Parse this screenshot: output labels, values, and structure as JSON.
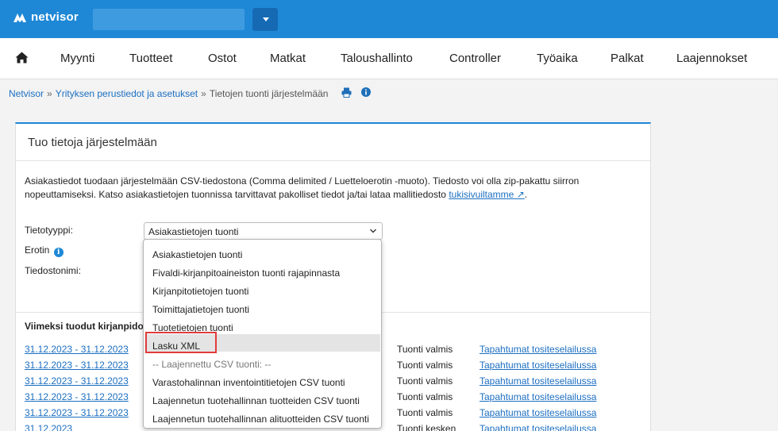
{
  "brand": {
    "name": "netvisor",
    "logo_icon": "netvisor-logo-icon"
  },
  "nav": {
    "home_icon": "home-icon",
    "items": [
      "Myynti",
      "Tuotteet",
      "Ostot",
      "Matkat",
      "Taloushallinto",
      "Controller",
      "Työaika",
      "Palkat",
      "Laajennokset"
    ]
  },
  "breadcrumb": {
    "items": [
      "Netvisor",
      "Yrityksen perustiedot ja asetukset",
      "Tietojen tuonti järjestelmään"
    ],
    "separator": "»",
    "icons": [
      "print-icon",
      "info-icon"
    ]
  },
  "panel": {
    "title": "Tuo tietoja järjestelmään",
    "description": "Asiakastiedot tuodaan järjestelmään CSV-tiedostona (Comma delimited / Luetteloerotin -muoto). Tiedosto voi olla zip-pakattu siirron nopeuttamiseksi. Katso asiakastietojen tuonnissa tarvittavat pakolliset tiedot ja/tai lataa mallitiedosto",
    "support_link": "tukisivuiltamme",
    "fields": {
      "type_label": "Tietotyyppi:",
      "type_value": "Asiakastietojen tuonti",
      "separator_label": "Erotin",
      "filename_label": "Tiedostonimi:"
    },
    "recent_title": "Viimeksi tuodut kirjanpido",
    "recent_rows": [
      {
        "date": "31.12.2023 - 31.12.2023",
        "status": "Tuonti valmis",
        "link": "Tapahtumat tositeselailussa"
      },
      {
        "date": "31.12.2023 - 31.12.2023",
        "status": "Tuonti valmis",
        "link": "Tapahtumat tositeselailussa"
      },
      {
        "date": "31.12.2023 - 31.12.2023",
        "status": "Tuonti valmis",
        "link": "Tapahtumat tositeselailussa"
      },
      {
        "date": "31.12.2023 - 31.12.2023",
        "status": "Tuonti valmis",
        "link": "Tapahtumat tositeselailussa"
      },
      {
        "date": "31.12.2023 - 31.12.2023",
        "status": "Tuonti valmis",
        "link": "Tapahtumat tositeselailussa"
      },
      {
        "date": "31.12.2023",
        "status": "Tuonti kesken",
        "link": "Tapahtumat tositeselailussa"
      }
    ]
  },
  "dropdown": {
    "options": [
      "Asiakastietojen tuonti",
      "Fivaldi-kirjanpitoaineiston tuonti rajapinnasta",
      "Kirjanpitotietojen tuonti",
      "Toimittajatietojen tuonti",
      "Tuotetietojen tuonti",
      "Lasku XML",
      "-- Laajennettu CSV tuonti: --",
      "Varastohalinnan inventointitietojen CSV tuonti",
      "Laajennetun tuotehallinnan tuotteiden CSV tuonti",
      "Laajennetun tuotehallinnan alituotteiden CSV tuonti"
    ],
    "selected": "Lasku XML"
  },
  "colors": {
    "brand_blue": "#1e88d6",
    "link": "#1c6fc1",
    "highlight": "#e03c3c"
  }
}
